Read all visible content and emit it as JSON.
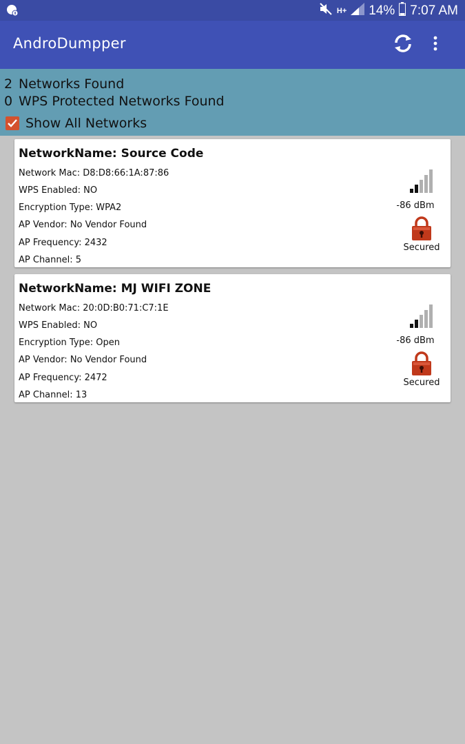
{
  "status_bar": {
    "battery": "14%",
    "time": "7:07 AM",
    "network_type": "H+"
  },
  "app_bar": {
    "title": "AndroDumpper",
    "refresh_icon": "refresh-icon",
    "overflow_icon": "more-vert-icon"
  },
  "summary": {
    "networks_count": "2",
    "networks_label": "Networks Found",
    "wps_count": "0",
    "wps_label": "WPS Protected Networks Found",
    "show_all_label": "Show All Networks",
    "show_all_checked": true
  },
  "networks": [
    {
      "name": "NetworkName: Source Code",
      "mac": "Network Mac: D8:D8:66:1A:87:86",
      "wps": "WPS Enabled: NO",
      "encryption": "Encryption Type: WPA2",
      "vendor": "AP Vendor: No Vendor Found",
      "frequency": "AP Frequency: 2432",
      "channel": "AP Channel: 5",
      "signal": "-86 dBm",
      "security": "Secured"
    },
    {
      "name": "NetworkName: MJ WIFI ZONE",
      "mac": "Network Mac: 20:0D:B0:71:C7:1E",
      "wps": "WPS Enabled: NO",
      "encryption": "Encryption Type: Open",
      "vendor": "AP Vendor: No Vendor Found",
      "frequency": "AP Frequency: 2472",
      "channel": "AP Channel: 13",
      "signal": "-86 dBm",
      "security": "Secured"
    }
  ],
  "colors": {
    "status_bar": "#3a4ba4",
    "app_bar": "#3f51b5",
    "summary_panel": "#639db3",
    "checkbox": "#d4522e",
    "lock": "#c0391b",
    "background": "#c4c4c4"
  }
}
